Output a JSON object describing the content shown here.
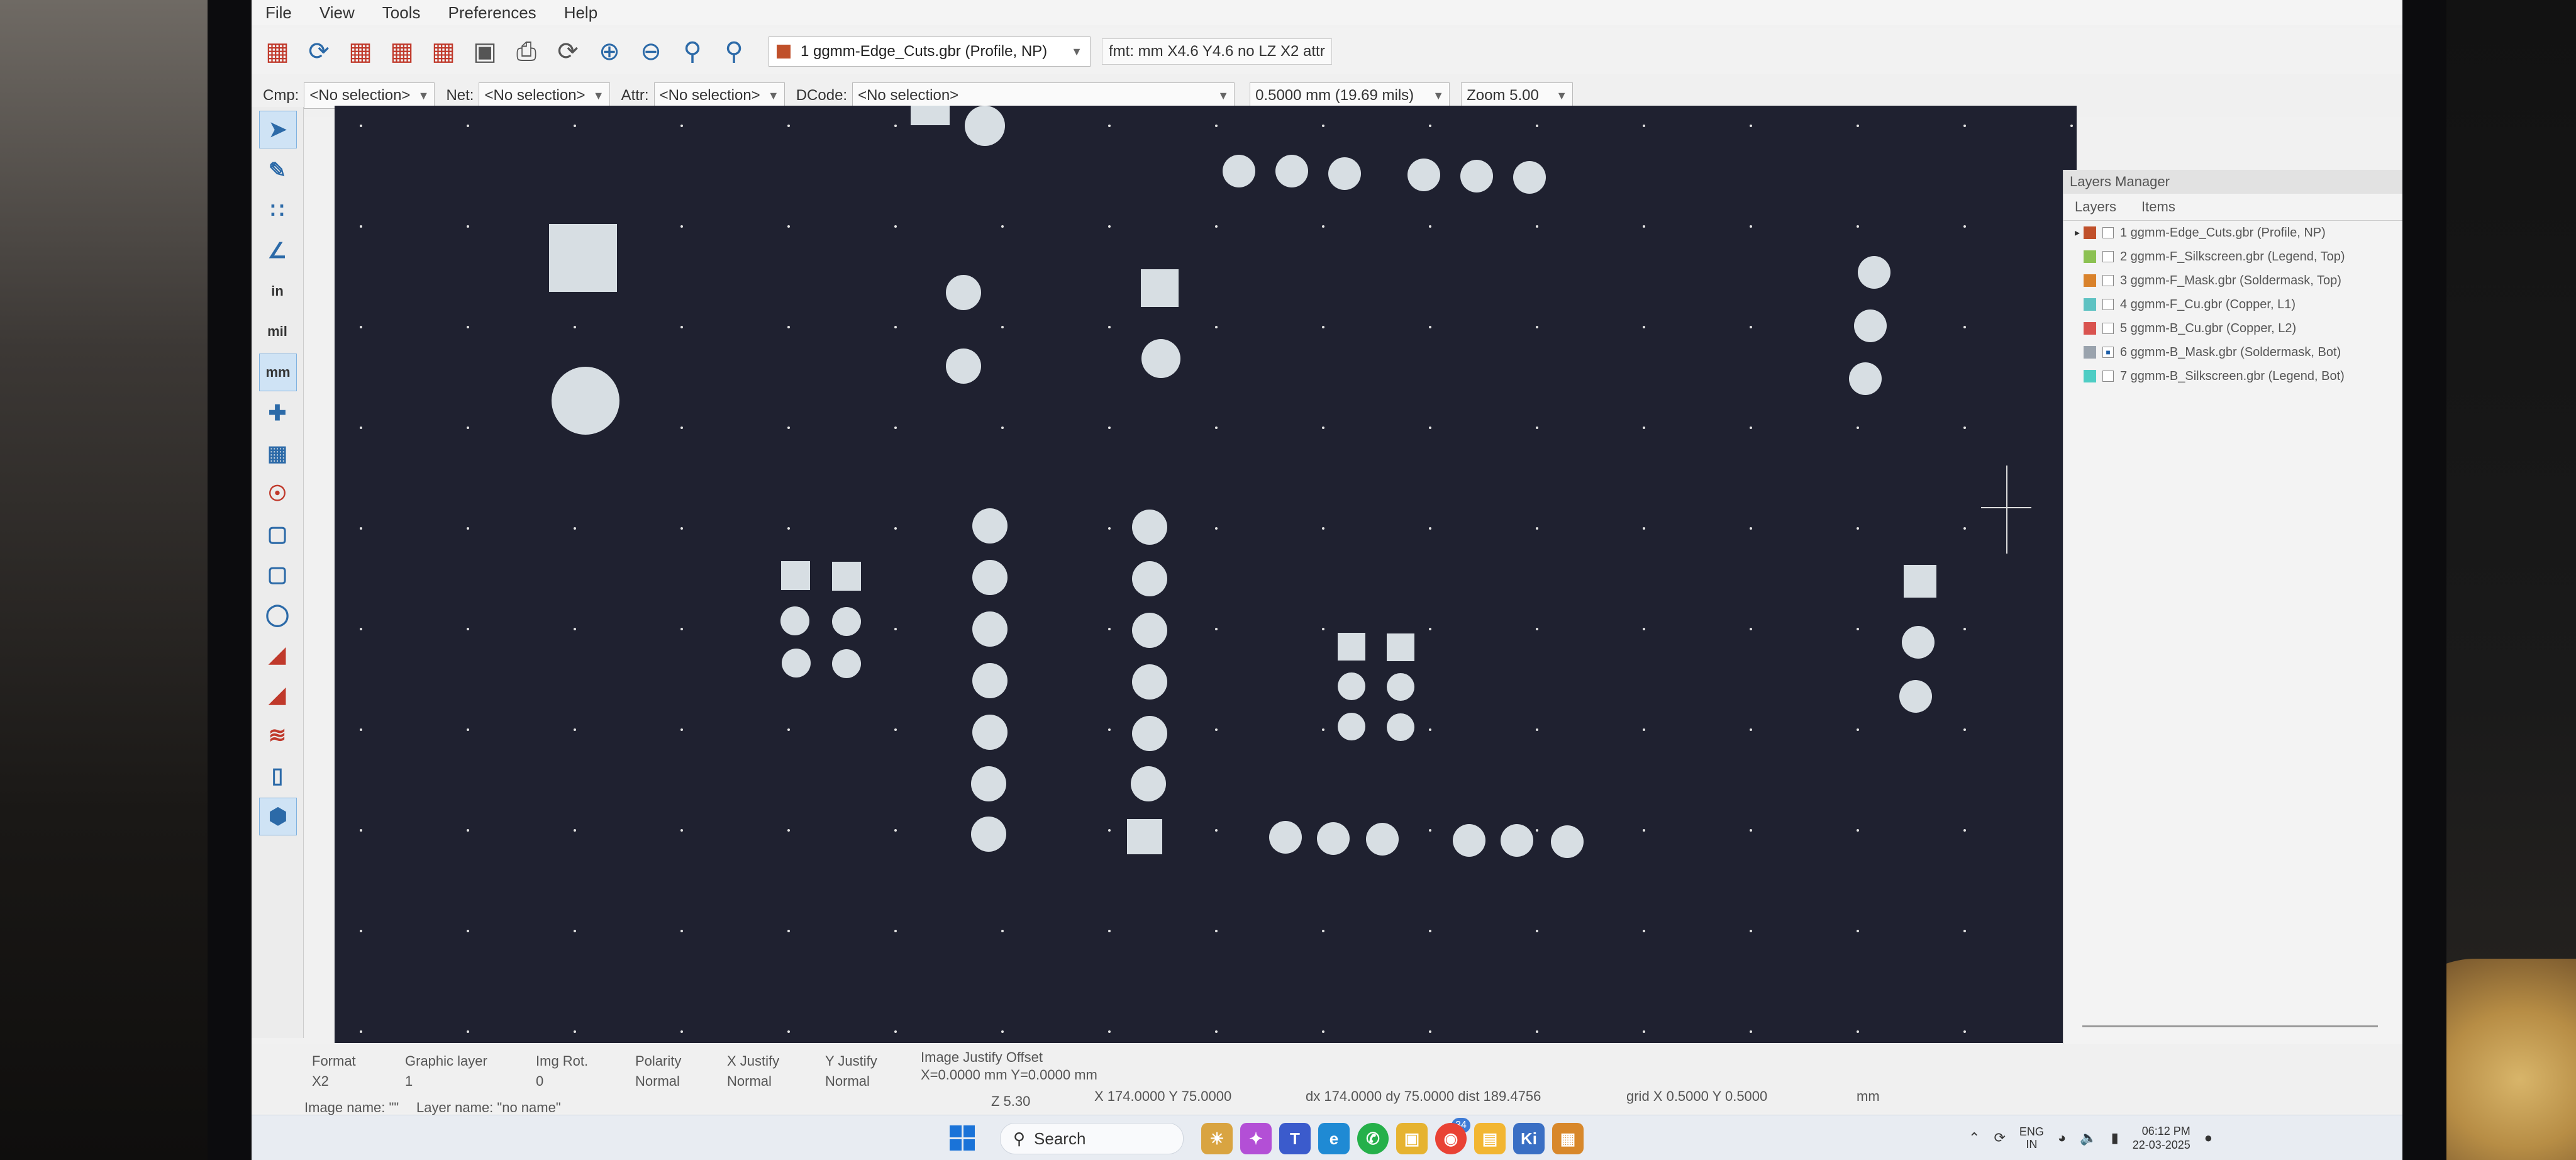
{
  "menu": {
    "file": "File",
    "view": "View",
    "tools": "Tools",
    "preferences": "Preferences",
    "help": "Help"
  },
  "toolbar": {
    "layer_select": "1 ggmm-Edge_Cuts.gbr (Profile, NP)",
    "layer_color": "#c0502a",
    "format_label": "fmt: mm X4.6 Y4.6 no LZ X2 attr"
  },
  "selectors": {
    "cmp_label": "Cmp:",
    "cmp_value": "<No selection>",
    "net_label": "Net:",
    "net_value": "<No selection>",
    "attr_label": "Attr:",
    "attr_value": "<No selection>",
    "dcode_label": "DCode:",
    "dcode_value": "<No selection>",
    "grid_value": "0.5000 mm (19.69 mils)",
    "zoom_value": "Zoom 5.00"
  },
  "left_toolbar": {
    "in_label": "in",
    "mil_label": "mil",
    "mm_label": "mm"
  },
  "layers_manager": {
    "title": "Layers Manager",
    "tab_layers": "Layers",
    "tab_items": "Items",
    "layers": [
      {
        "label": "1 ggmm-Edge_Cuts.gbr (Profile, NP)",
        "color": "#c0502a",
        "active": true,
        "checked": false
      },
      {
        "label": "2 ggmm-F_Silkscreen.gbr (Legend, Top)",
        "color": "#8cc152",
        "active": false,
        "checked": false
      },
      {
        "label": "3 ggmm-F_Mask.gbr (Soldermask, Top)",
        "color": "#d9822b",
        "active": false,
        "checked": false
      },
      {
        "label": "4 ggmm-F_Cu.gbr (Copper, L1)",
        "color": "#5ec2c2",
        "active": false,
        "checked": false
      },
      {
        "label": "5 ggmm-B_Cu.gbr (Copper, L2)",
        "color": "#d9534f",
        "active": false,
        "checked": false
      },
      {
        "label": "6 ggmm-B_Mask.gbr (Soldermask, Bot)",
        "color": "#9aa3ad",
        "active": false,
        "checked": true
      },
      {
        "label": "7 ggmm-B_Silkscreen.gbr (Legend, Bot)",
        "color": "#4ecdc4",
        "active": false,
        "checked": false
      }
    ]
  },
  "status": {
    "format_label": "Format",
    "format_value": "X2",
    "graphic_layer_label": "Graphic layer",
    "graphic_layer_value": "1",
    "img_rot_label": "Img Rot.",
    "img_rot_value": "0",
    "polarity_label": "Polarity",
    "polarity_value": "Normal",
    "x_justify_label": "X Justify",
    "x_justify_value": "Normal",
    "y_justify_label": "Y Justify",
    "y_justify_value": "Normal",
    "offset_label": "Image Justify Offset",
    "offset_value": "X=0.0000 mm Y=0.0000 mm",
    "z_readout": "Z 5.30",
    "xy_readout": "X 174.0000  Y 75.0000",
    "delta_readout": "dx 174.0000  dy 75.0000  dist 189.4756",
    "grid_readout": "grid X 0.5000  Y 0.5000",
    "units": "mm",
    "image_name": "Image name: \"\"",
    "layer_name": "Layer name: \"no name\""
  },
  "taskbar": {
    "search_label": "Search",
    "notification_count": "34",
    "lang_line1": "ENG",
    "lang_line2": "IN",
    "time": "06:12 PM",
    "date": "22-03-2025"
  }
}
